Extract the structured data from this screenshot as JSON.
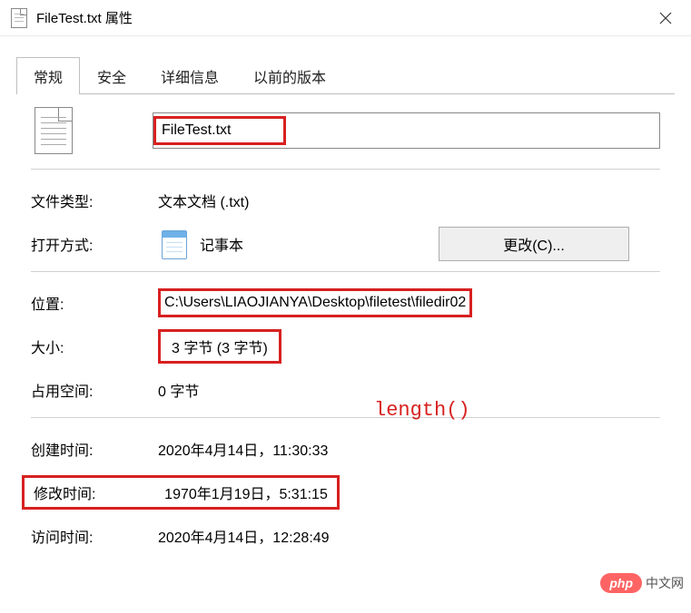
{
  "title": "FileTest.txt 属性",
  "tabs": {
    "general": "常规",
    "security": "安全",
    "details": "详细信息",
    "previous": "以前的版本"
  },
  "filename": "FileTest.txt",
  "labels": {
    "filetype": "文件类型:",
    "openwith": "打开方式:",
    "location": "位置:",
    "size": "大小:",
    "diskspace": "占用空间:",
    "created": "创建时间:",
    "modified": "修改时间:",
    "accessed": "访问时间:"
  },
  "values": {
    "filetype": "文本文档 (.txt)",
    "openwith": "记事本",
    "change_btn": "更改(C)...",
    "location": "C:\\Users\\LIAOJIANYA\\Desktop\\filetest\\filedir02",
    "size": "3 字节 (3 字节)",
    "diskspace": "0 字节",
    "created": "2020年4月14日，11:30:33",
    "modified": "1970年1月19日，5:31:15",
    "accessed": "2020年4月14日，12:28:49"
  },
  "annotations": {
    "length": "length()"
  },
  "watermark": {
    "logo": "php",
    "text": "中文网"
  }
}
